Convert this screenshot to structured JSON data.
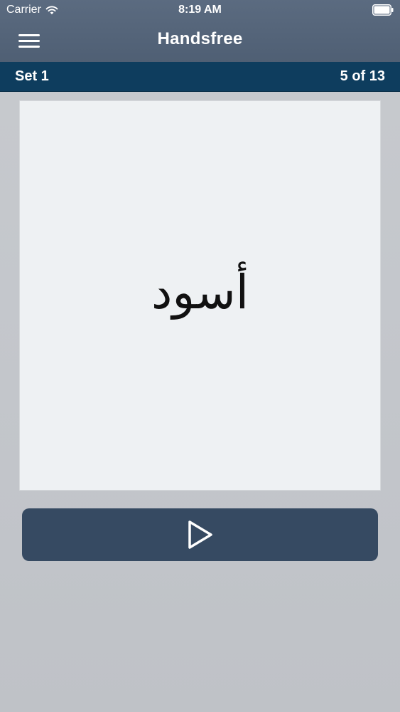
{
  "status_bar": {
    "carrier": "Carrier",
    "time": "8:19 AM",
    "icons": [
      "wifi-icon",
      "battery-icon"
    ]
  },
  "nav_bar": {
    "title": "Handsfree",
    "menu_icon": "hamburger-menu-icon"
  },
  "set_bar": {
    "set_name": "Set 1",
    "progress": "5 of 13"
  },
  "card": {
    "word": "أسود"
  },
  "controls": {
    "play_icon": "play-icon"
  },
  "colors": {
    "nav_bar": "#55657a",
    "set_bar": "#0e3d5e",
    "card": "#eef1f3",
    "play_button": "#364a62",
    "background": "#c4c7cb"
  }
}
